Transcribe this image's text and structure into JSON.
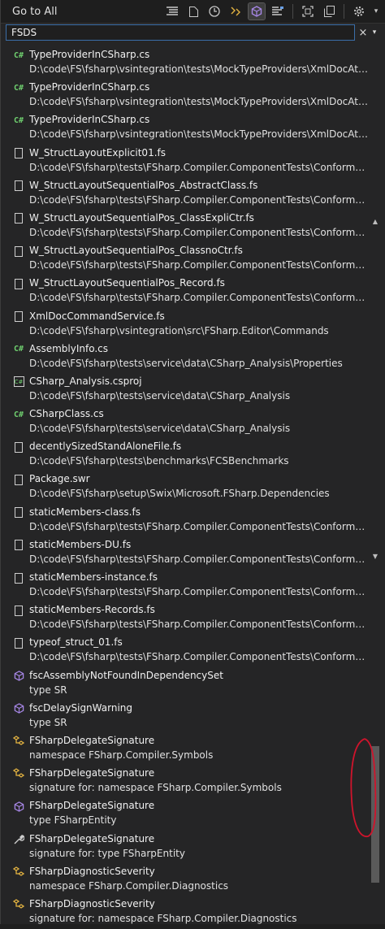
{
  "header": {
    "title": "Go to All",
    "toolbar_icons": [
      "list-icon",
      "file-icon",
      "clock-icon",
      "struct-icon",
      "cube-icon",
      "symbol-icon",
      "frame-icon",
      "copy-icon",
      "gear-icon"
    ]
  },
  "search": {
    "value": "FSDS",
    "clear_label": "×",
    "dropdown_label": "▾"
  },
  "results": [
    {
      "icon": "csharp",
      "name": "TypeProviderInCSharp.cs",
      "path": "D:\\code\\FS\\fsharp\\vsintegration\\tests\\MockTypeProviders\\XmlDocAttribut..."
    },
    {
      "icon": "csharp",
      "name": "TypeProviderInCSharp.cs",
      "path": "D:\\code\\FS\\fsharp\\vsintegration\\tests\\MockTypeProviders\\XmlDocAttribut..."
    },
    {
      "icon": "csharp",
      "name": "TypeProviderInCSharp.cs",
      "path": "D:\\code\\FS\\fsharp\\vsintegration\\tests\\MockTypeProviders\\XmlDocAttribut..."
    },
    {
      "icon": "file",
      "name": "W_StructLayoutExplicit01.fs",
      "path": "D:\\code\\FS\\fsharp\\tests\\FSharp.Compiler.ComponentTests\\Conformance\\..."
    },
    {
      "icon": "file",
      "name": "W_StructLayoutSequentialPos_AbstractClass.fs",
      "path": "D:\\code\\FS\\fsharp\\tests\\FSharp.Compiler.ComponentTests\\Conformance\\..."
    },
    {
      "icon": "file",
      "name": "W_StructLayoutSequentialPos_ClassExpliCtr.fs",
      "path": "D:\\code\\FS\\fsharp\\tests\\FSharp.Compiler.ComponentTests\\Conformance\\..."
    },
    {
      "icon": "file",
      "name": "W_StructLayoutSequentialPos_ClassnoCtr.fs",
      "path": "D:\\code\\FS\\fsharp\\tests\\FSharp.Compiler.ComponentTests\\Conformance\\..."
    },
    {
      "icon": "file",
      "name": "W_StructLayoutSequentialPos_Record.fs",
      "path": "D:\\code\\FS\\fsharp\\tests\\FSharp.Compiler.ComponentTests\\Conformance\\..."
    },
    {
      "icon": "file",
      "name": "XmlDocCommandService.fs",
      "path": "D:\\code\\FS\\fsharp\\vsintegration\\src\\FSharp.Editor\\Commands"
    },
    {
      "icon": "csharp",
      "name": "AssemblyInfo.cs",
      "path": "D:\\code\\FS\\fsharp\\tests\\service\\data\\CSharp_Analysis\\Properties"
    },
    {
      "icon": "project",
      "name": "CSharp_Analysis.csproj",
      "path": "D:\\code\\FS\\fsharp\\tests\\service\\data\\CSharp_Analysis"
    },
    {
      "icon": "csharp",
      "name": "CSharpClass.cs",
      "path": "D:\\code\\FS\\fsharp\\tests\\service\\data\\CSharp_Analysis"
    },
    {
      "icon": "file",
      "name": "decentlySizedStandAloneFile.fs",
      "path": "D:\\code\\FS\\fsharp\\tests\\benchmarks\\FCSBenchmarks"
    },
    {
      "icon": "file",
      "name": "Package.swr",
      "path": "D:\\code\\FS\\fsharp\\setup\\Swix\\Microsoft.FSharp.Dependencies"
    },
    {
      "icon": "file",
      "name": "staticMembers-class.fs",
      "path": "D:\\code\\FS\\fsharp\\tests\\FSharp.Compiler.ComponentTests\\Conformance\\..."
    },
    {
      "icon": "file",
      "name": "staticMembers-DU.fs",
      "path": "D:\\code\\FS\\fsharp\\tests\\FSharp.Compiler.ComponentTests\\Conformance\\..."
    },
    {
      "icon": "file",
      "name": "staticMembers-instance.fs",
      "path": "D:\\code\\FS\\fsharp\\tests\\FSharp.Compiler.ComponentTests\\Conformance\\..."
    },
    {
      "icon": "file",
      "name": "staticMembers-Records.fs",
      "path": "D:\\code\\FS\\fsharp\\tests\\FSharp.Compiler.ComponentTests\\Conformance\\..."
    },
    {
      "icon": "file",
      "name": "typeof_struct_01.fs",
      "path": "D:\\code\\FS\\fsharp\\tests\\FSharp.Compiler.ComponentTests\\Conformance\\..."
    },
    {
      "icon": "cube",
      "name": "fscAssemblyNotFoundInDependencySet",
      "path": "type SR"
    },
    {
      "icon": "cube",
      "name": "fscDelaySignWarning",
      "path": "type SR"
    },
    {
      "icon": "struct",
      "name": "FSharpDelegateSignature",
      "path": "namespace FSharp.Compiler.Symbols"
    },
    {
      "icon": "struct",
      "name": "FSharpDelegateSignature",
      "path": "signature for: namespace FSharp.Compiler.Symbols"
    },
    {
      "icon": "cube",
      "name": "FSharpDelegateSignature",
      "path": "type FSharpEntity"
    },
    {
      "icon": "wrench",
      "name": "FSharpDelegateSignature",
      "path": "signature for: type FSharpEntity"
    },
    {
      "icon": "struct",
      "name": "FSharpDiagnosticSeverity",
      "path": "namespace FSharp.Compiler.Diagnostics"
    },
    {
      "icon": "struct",
      "name": "FSharpDiagnosticSeverity",
      "path": "signature for: namespace FSharp.Compiler.Diagnostics"
    }
  ],
  "annotation_color": "#d0142c",
  "accent_color": "#3b6ea8"
}
